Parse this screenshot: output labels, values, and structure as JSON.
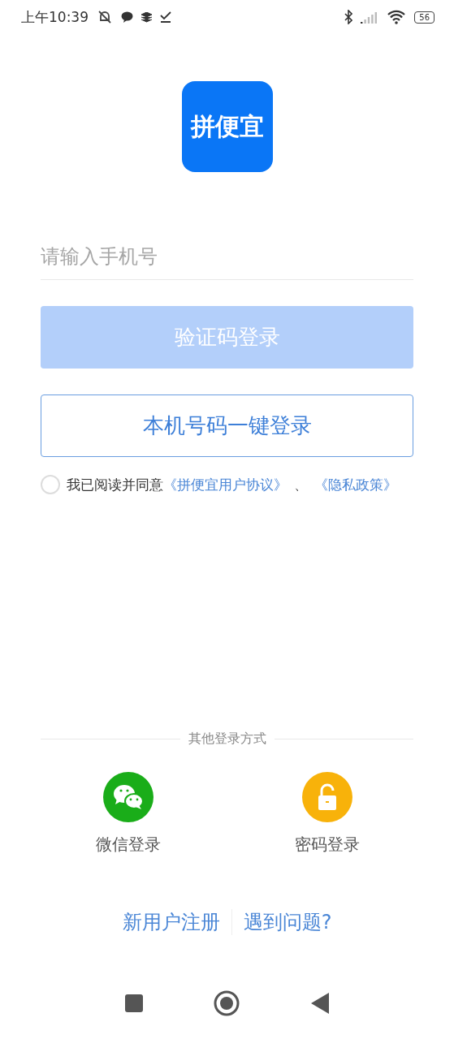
{
  "status_bar": {
    "time": "上午10:39",
    "battery": "56"
  },
  "logo": {
    "text": "拼便宜"
  },
  "phone_field": {
    "placeholder": "请输入手机号"
  },
  "buttons": [
    {
      "label": "验证码登录",
      "kind": "filled",
      "disabled": true
    },
    {
      "label": "本机号码一键登录",
      "kind": "outline",
      "disabled": false
    }
  ],
  "agreement": {
    "checked": false,
    "text": "我已阅读并同意",
    "links": [
      "《拼便宜用户协议》",
      "《隐私政策》"
    ],
    "separator": "、"
  },
  "other_login": {
    "title": "其他登录方式",
    "options": [
      {
        "label": "微信登录",
        "kind": "wechat"
      },
      {
        "label": "密码登录",
        "kind": "password"
      }
    ]
  },
  "footer_links": [
    "新用户注册",
    "遇到问题?"
  ]
}
